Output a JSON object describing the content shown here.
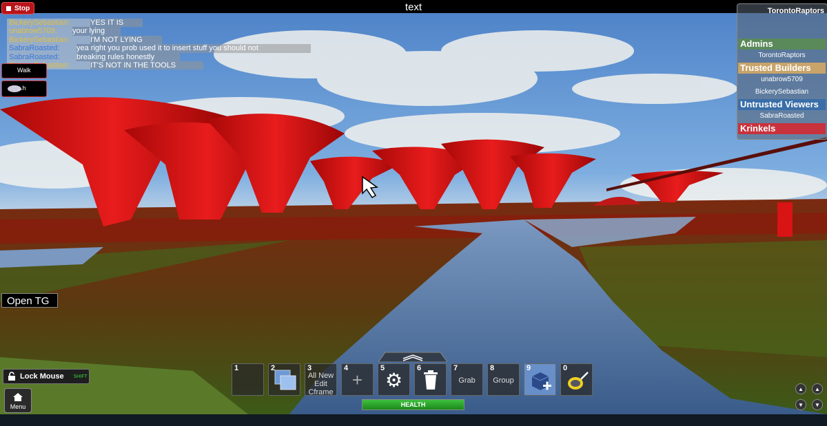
{
  "topbar": {
    "title": "text"
  },
  "stop_button": {
    "label": "Stop"
  },
  "chat": [
    {
      "name": "BickerySebastian:",
      "name_color": "#e0c040",
      "message": "YES IT IS"
    },
    {
      "name": "unabrow5709:",
      "name_color": "#e0c040",
      "message": "your lying"
    },
    {
      "name": "BickerySebastian:",
      "name_color": "#e0c040",
      "message": "I'M NOT LYING"
    },
    {
      "name": "SabraRoasted:",
      "name_color": "#3a78d8",
      "message": "yea right you prob used it to insert stuff you should not"
    },
    {
      "name": "SabraRoasted:",
      "name_color": "#3a78d8",
      "message": "breaking rules honestly"
    },
    {
      "name": "BickerySebastian:",
      "name_color": "#e0c040",
      "message": "IT'S NOT IN THE TOOLS"
    }
  ],
  "side_buttons": {
    "walk": "Walk",
    "chat": "...h"
  },
  "leaderboard": {
    "title": "TorontoRaptors",
    "teams": [
      {
        "name": "Admins",
        "color": "#5a8a5a",
        "players": [
          "TorontoRaptors"
        ]
      },
      {
        "name": "Trusted Builders",
        "color": "#c8a46a",
        "players": [
          "unabrow5709",
          "BickerySebastian"
        ]
      },
      {
        "name": "Untrusted Viewers",
        "color": "#3a6ea8",
        "players": [
          "SabraRoasted"
        ]
      },
      {
        "name": "Krinkels",
        "color": "#c8323c",
        "players": []
      }
    ]
  },
  "open_tg": {
    "label": "Open TG"
  },
  "lock_mouse": {
    "label": "Lock Mouse",
    "hint": "SHIFT"
  },
  "menu": {
    "label": "Menu"
  },
  "hotbar": [
    {
      "num": "1",
      "label": "",
      "icon": "empty"
    },
    {
      "num": "2",
      "label": "",
      "icon": "copy-icon"
    },
    {
      "num": "3",
      "label": "All New Edit Cframe",
      "icon": ""
    },
    {
      "num": "4",
      "label": "",
      "icon": "plus-icon"
    },
    {
      "num": "5",
      "label": "",
      "icon": "gear-icon"
    },
    {
      "num": "6",
      "label": "",
      "icon": "trash-icon"
    },
    {
      "num": "7",
      "label": "Grab",
      "icon": ""
    },
    {
      "num": "8",
      "label": "Group",
      "icon": ""
    },
    {
      "num": "9",
      "label": "",
      "icon": "insert-block-icon",
      "selected": true
    },
    {
      "num": "0",
      "label": "",
      "icon": "paint-bucket-icon"
    }
  ],
  "health": {
    "label": "HEALTH",
    "level": 1.0
  },
  "colors": {
    "stop": "#b8141a",
    "health": "#2aa02a",
    "terrain_red": "#d81414"
  }
}
